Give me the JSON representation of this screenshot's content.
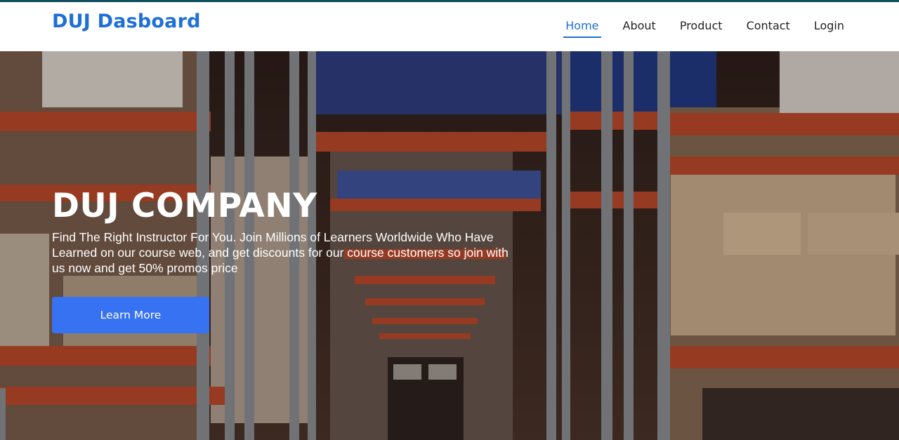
{
  "navbar": {
    "brand": "DUJ Dasboard",
    "links": [
      {
        "label": "Home",
        "active": true
      },
      {
        "label": "About",
        "active": false
      },
      {
        "label": "Product",
        "active": false
      },
      {
        "label": "Contact",
        "active": false
      },
      {
        "label": "Login",
        "active": false
      }
    ]
  },
  "hero": {
    "title": "DUJ COMPANY",
    "description": "Find The Right Instructor For You. Join Millions of Learners Worldwide Who Have Learned on our course web, and get discounts for our course customers so join with us now and get 50% promos price",
    "button_label": "Learn More",
    "background": "warehouse-aisle-image"
  },
  "colors": {
    "accent": "#1e6fd6",
    "button": "#3672f2",
    "top_border": "#0e4f5c"
  }
}
